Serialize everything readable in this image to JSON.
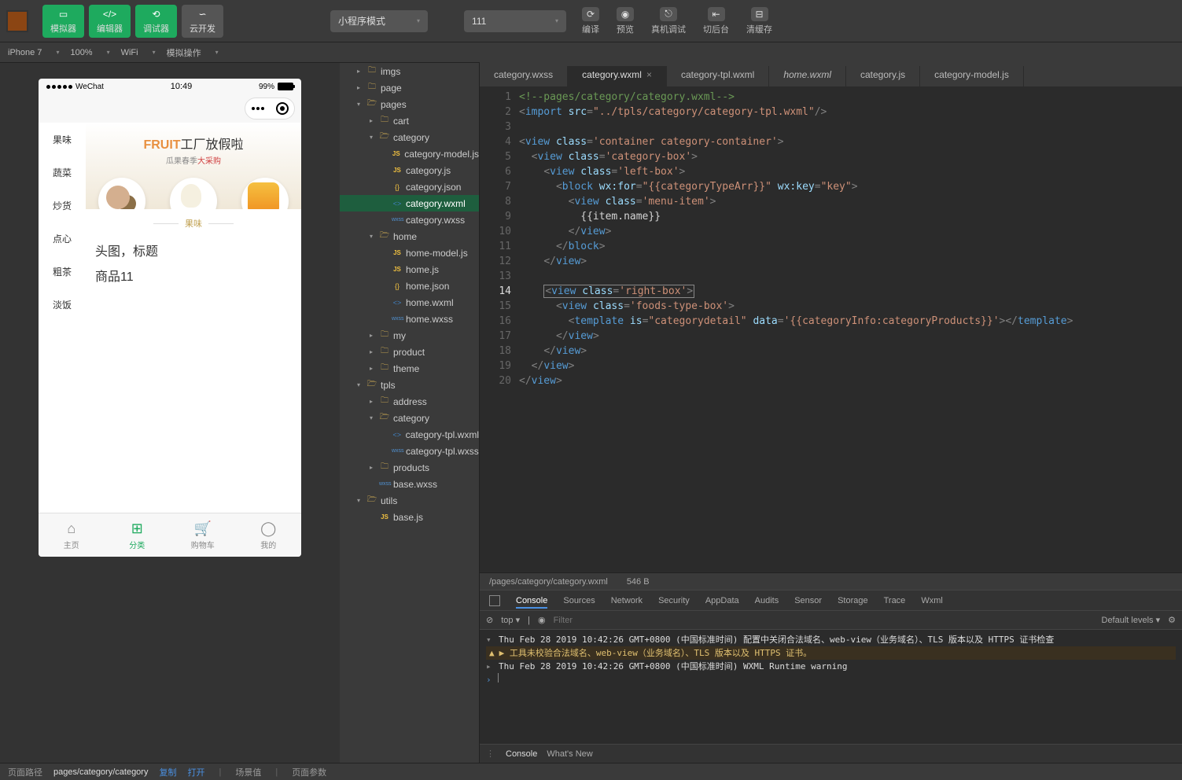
{
  "toolbar": {
    "simulator": "模拟器",
    "editor": "编辑器",
    "debugger": "调试器",
    "cloud": "云开发",
    "mode": "小程序模式",
    "project": "111",
    "compile": "编译",
    "preview": "预览",
    "remote": "真机调试",
    "background": "切后台",
    "cache": "清缓存"
  },
  "subbar": {
    "device": "iPhone 7",
    "zoom": "100%",
    "network": "WiFi",
    "simop": "模拟操作"
  },
  "tree": [
    {
      "i": 1,
      "t": "f",
      "c": "▸",
      "n": "imgs"
    },
    {
      "i": 1,
      "t": "f",
      "c": "▸",
      "n": "page"
    },
    {
      "i": 1,
      "t": "f",
      "c": "▾",
      "n": "pages",
      "open": true
    },
    {
      "i": 2,
      "t": "f",
      "c": "▸",
      "n": "cart"
    },
    {
      "i": 2,
      "t": "f",
      "c": "▾",
      "n": "category",
      "open": true
    },
    {
      "i": 3,
      "t": "js",
      "n": "category-model.js"
    },
    {
      "i": 3,
      "t": "js",
      "n": "category.js"
    },
    {
      "i": 3,
      "t": "json",
      "n": "category.json"
    },
    {
      "i": 3,
      "t": "wxml",
      "n": "category.wxml",
      "active": true
    },
    {
      "i": 3,
      "t": "wxss",
      "n": "category.wxss"
    },
    {
      "i": 2,
      "t": "f",
      "c": "▾",
      "n": "home",
      "open": true
    },
    {
      "i": 3,
      "t": "js",
      "n": "home-model.js"
    },
    {
      "i": 3,
      "t": "js",
      "n": "home.js"
    },
    {
      "i": 3,
      "t": "json",
      "n": "home.json"
    },
    {
      "i": 3,
      "t": "wxml",
      "n": "home.wxml"
    },
    {
      "i": 3,
      "t": "wxss",
      "n": "home.wxss"
    },
    {
      "i": 2,
      "t": "f",
      "c": "▸",
      "n": "my"
    },
    {
      "i": 2,
      "t": "f",
      "c": "▸",
      "n": "product"
    },
    {
      "i": 2,
      "t": "f",
      "c": "▸",
      "n": "theme"
    },
    {
      "i": 1,
      "t": "f",
      "c": "▾",
      "n": "tpls",
      "open": true
    },
    {
      "i": 2,
      "t": "f",
      "c": "▸",
      "n": "address"
    },
    {
      "i": 2,
      "t": "f",
      "c": "▾",
      "n": "category",
      "open": true
    },
    {
      "i": 3,
      "t": "wxml",
      "n": "category-tpl.wxml"
    },
    {
      "i": 3,
      "t": "wxss",
      "n": "category-tpl.wxss"
    },
    {
      "i": 2,
      "t": "f",
      "c": "▸",
      "n": "products"
    },
    {
      "i": 2,
      "t": "wxss",
      "n": "base.wxss"
    },
    {
      "i": 1,
      "t": "f",
      "c": "▾",
      "n": "utils",
      "open": true
    },
    {
      "i": 2,
      "t": "js",
      "n": "base.js"
    }
  ],
  "tabs": [
    {
      "n": "category.wxss"
    },
    {
      "n": "category.wxml",
      "active": true,
      "close": true
    },
    {
      "n": "category-tpl.wxml"
    },
    {
      "n": "home.wxml",
      "italic": true
    },
    {
      "n": "category.js"
    },
    {
      "n": "category-model.js"
    }
  ],
  "code": {
    "lines": 20,
    "current": 14
  },
  "editorStatus": {
    "path": "/pages/category/category.wxml",
    "size": "546 B"
  },
  "simulator": {
    "carrier": "WeChat",
    "time": "10:49",
    "battery": "99%",
    "categories": [
      "果味",
      "蔬菜",
      "炒货",
      "点心",
      "粗茶",
      "淡饭"
    ],
    "bannerTitle1": "FRUIT",
    "bannerTitle2": "工厂放假啦",
    "bannerSub1": "瓜果春季",
    "bannerSub2": "大采购",
    "catLabel": "果味",
    "prodTitle": "头图，标题",
    "prodItem": "商品11",
    "tabs": [
      "主页",
      "分类",
      "购物车",
      "我的"
    ]
  },
  "devtools": {
    "tabs": [
      "Console",
      "Sources",
      "Network",
      "Security",
      "AppData",
      "Audits",
      "Sensor",
      "Storage",
      "Trace",
      "Wxml"
    ],
    "context": "top",
    "filterPlaceholder": "Filter",
    "levels": "Default levels ▾",
    "log1": "Thu Feb 28 2019 10:42:26 GMT+0800 (中国标准时间) 配置中关闭合法域名、web-view（业务域名）、TLS 版本以及 HTTPS 证书检查",
    "warn": "▶ 工具未校验合法域名、web-view（业务域名）、TLS 版本以及 HTTPS 证书。",
    "log2": "Thu Feb 28 2019 10:42:26 GMT+0800 (中国标准时间) WXML Runtime warning",
    "bottomConsole": "Console",
    "whatsNew": "What's New"
  },
  "statusbar": {
    "label": "页面路径",
    "path": "pages/category/category",
    "copy": "复制",
    "open": "打开",
    "scene": "场景值",
    "params": "页面参数"
  }
}
